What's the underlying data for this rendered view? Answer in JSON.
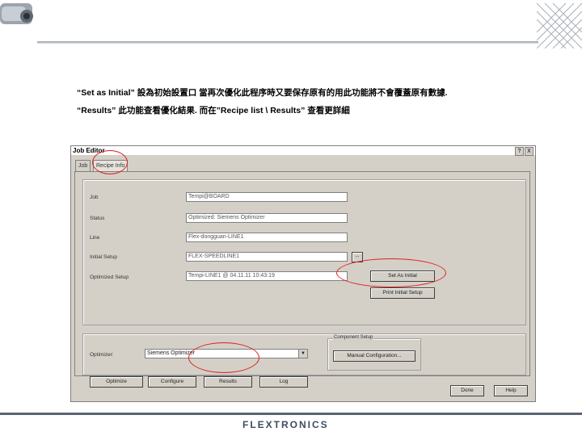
{
  "annotations": {
    "line1": "“Set as Initial” 設為初始設置口 當再次優化此程序時又要保存原有的用此功能將不會覆蓋原有數據.",
    "line2": "“Results” 此功能查看優化結果. 而在”Recipe list \\ Results” 查看更詳細"
  },
  "dialog": {
    "title": "Job Editor",
    "help": "?",
    "close": "X",
    "tabs": [
      {
        "label": "Job"
      },
      {
        "label": "Recipe Info"
      }
    ],
    "rows": [
      {
        "label": "Job",
        "value": "Tempi@BOARD"
      },
      {
        "label": "Status",
        "value": "Optimized: Siemens Optimizer"
      },
      {
        "label": "Line",
        "value": "Flex-dongguan-LINE1"
      },
      {
        "label": "Initial Setup",
        "value": "FLEX-SPEEDLINE1"
      },
      {
        "label": "Optimized Setup",
        "value": "Tempi-LINE1 @ 04.11.11 10:43:19"
      }
    ],
    "browse_label": "...",
    "set_as_initial_label": "Set As Initial",
    "print_initial_setup_label": "Print Initial Setup",
    "optimizer": {
      "label": "Optimizer:",
      "selected": "Siemens Optimizer"
    },
    "component_setup": {
      "title": "Component Setup",
      "button": "Manual Configuration..."
    },
    "actions": {
      "optimize": "Optimize",
      "configure": "Configure",
      "results": "Results",
      "log": "Log"
    },
    "done": "Done",
    "help_button": "Help"
  },
  "footer": {
    "logo": "FLEXTRONICS"
  },
  "colors": {
    "highlight_ring": "#e02020",
    "dialog_face": "#d4d0c8",
    "logo": "#3d4d64"
  }
}
